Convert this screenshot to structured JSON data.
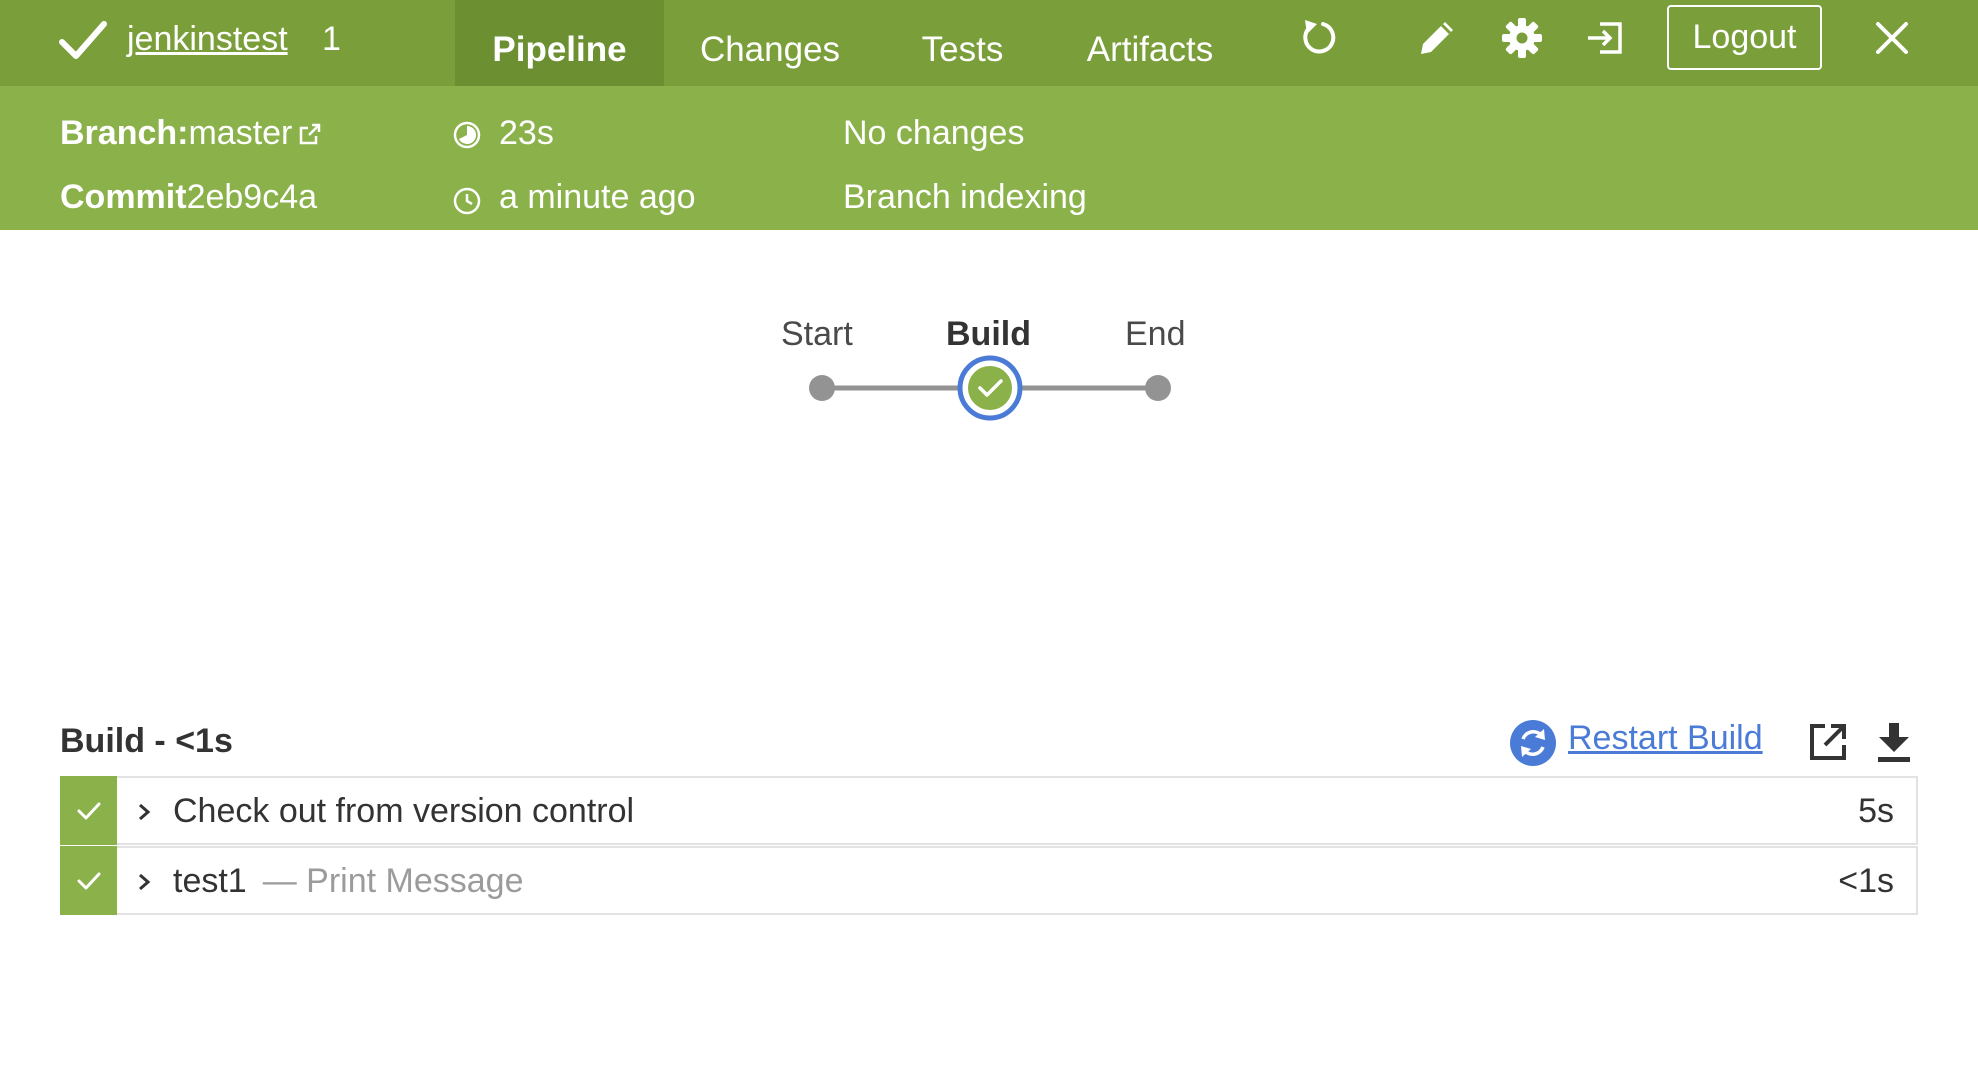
{
  "header": {
    "job_name": "jenkinstest",
    "run_number": "1",
    "tabs": [
      {
        "label": "Pipeline",
        "active": true
      },
      {
        "label": "Changes",
        "active": false
      },
      {
        "label": "Tests",
        "active": false
      },
      {
        "label": "Artifacts",
        "active": false
      }
    ],
    "icons": [
      "replay-icon",
      "edit-icon",
      "gear-icon",
      "exit-icon",
      "close-icon"
    ],
    "logout_label": "Logout"
  },
  "run_info": {
    "branch_label": "Branch:",
    "branch_value": "master",
    "commit_label": "Commit",
    "commit_value": "2eb9c4a",
    "duration": "23s",
    "time_ago": "a minute ago",
    "changes": "No changes",
    "cause": "Branch indexing"
  },
  "pipeline": {
    "stages": [
      {
        "label": "Start",
        "status": "none"
      },
      {
        "label": "Build",
        "status": "success",
        "selected": true
      },
      {
        "label": "End",
        "status": "none"
      }
    ]
  },
  "stage_detail": {
    "title": "Build - <1s",
    "restart_label": "Restart Build",
    "steps": [
      {
        "name": "Check out from version control",
        "description": "",
        "duration": "5s",
        "status": "success"
      },
      {
        "name": "test1",
        "description": "— Print Message",
        "duration": "<1s",
        "status": "success"
      }
    ]
  },
  "colors": {
    "topbar": "#7a9e3a",
    "infobar": "#8ab14a",
    "active_tab": "#6b8f31",
    "success": "#8ab14a",
    "selected_ring": "#4a7bd6",
    "link": "#4a7bd6"
  }
}
